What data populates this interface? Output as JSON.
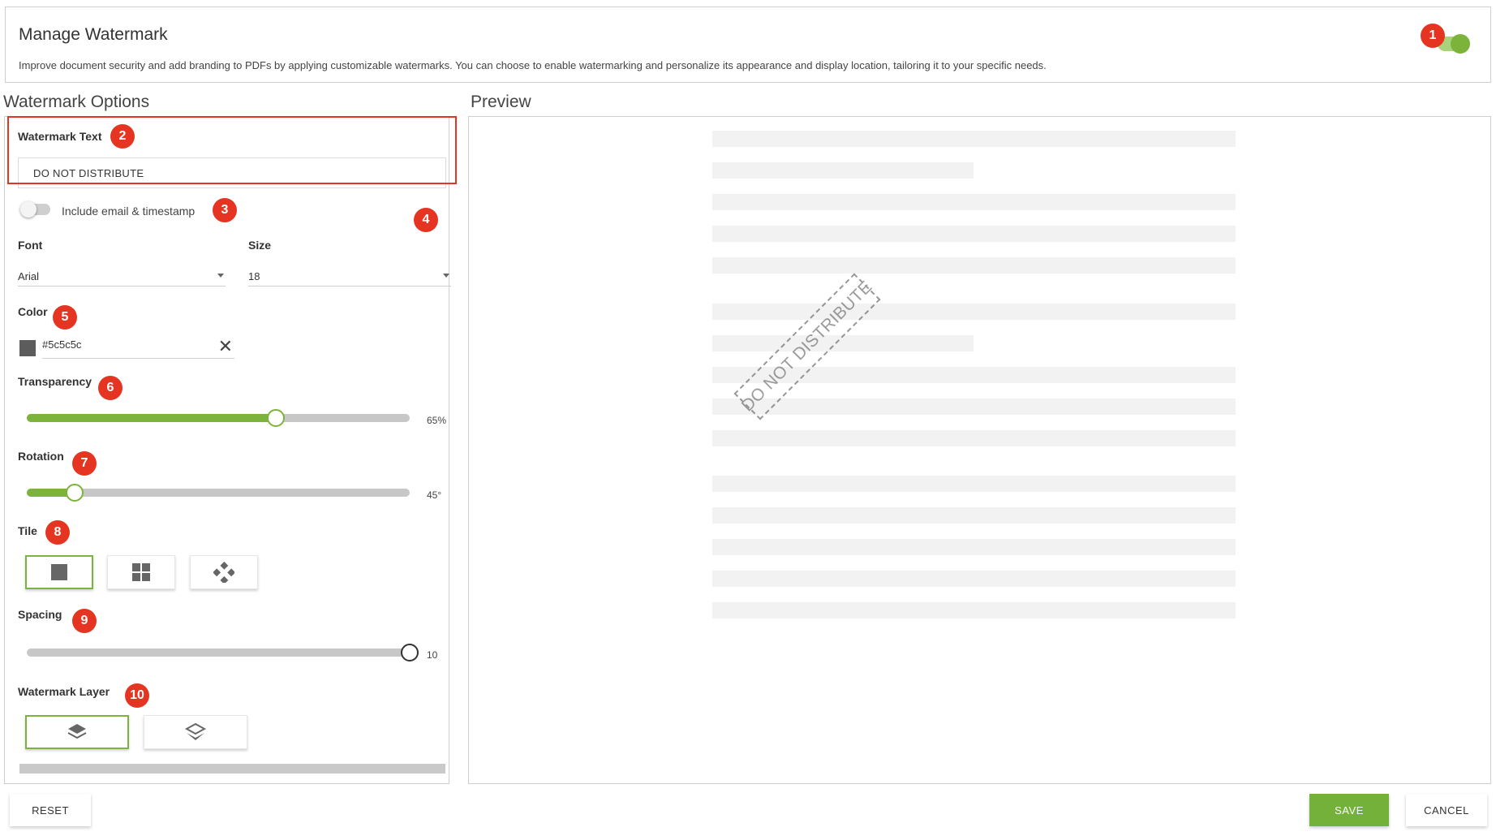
{
  "header": {
    "title": "Manage Watermark",
    "description": "Improve document security and add branding to PDFs by applying customizable watermarks. You can choose to enable watermarking and personalize its appearance and display location, tailoring it to your specific needs.",
    "enabled": true
  },
  "sections": {
    "options_title": "Watermark Options",
    "preview_title": "Preview"
  },
  "options": {
    "watermark_text_label": "Watermark Text",
    "watermark_text_value": "DO NOT DISTRIBUTE",
    "include_label": "Include email & timestamp",
    "font_label": "Font",
    "font_value": "Arial",
    "size_label": "Size",
    "size_value": "18",
    "color_label": "Color",
    "color_value": "#5c5c5c",
    "transparency_label": "Transparency",
    "transparency_value": "65%",
    "transparency_fraction": 0.65,
    "rotation_label": "Rotation",
    "rotation_value": "45°",
    "rotation_fraction": 0.125,
    "tile_label": "Tile",
    "spacing_label": "Spacing",
    "spacing_value": "10",
    "spacing_fraction": 1.0,
    "layer_label": "Watermark Layer"
  },
  "preview": {
    "watermark_text": "DO NOT DISTRIBUTE"
  },
  "badges": [
    "1",
    "2",
    "3",
    "4",
    "5",
    "6",
    "7",
    "8",
    "9",
    "10"
  ],
  "footer": {
    "reset": "RESET",
    "save": "SAVE",
    "cancel": "CANCEL"
  },
  "colors": {
    "accent": "#7bb33b",
    "annotation": "#e53522"
  },
  "icons": {
    "tile_single": "square-icon",
    "tile_grid": "grid-icon",
    "tile_diamond": "diamond-grid-icon",
    "layer_front": "layers-front-icon",
    "layer_back": "layers-back-icon",
    "clear": "close-icon"
  }
}
